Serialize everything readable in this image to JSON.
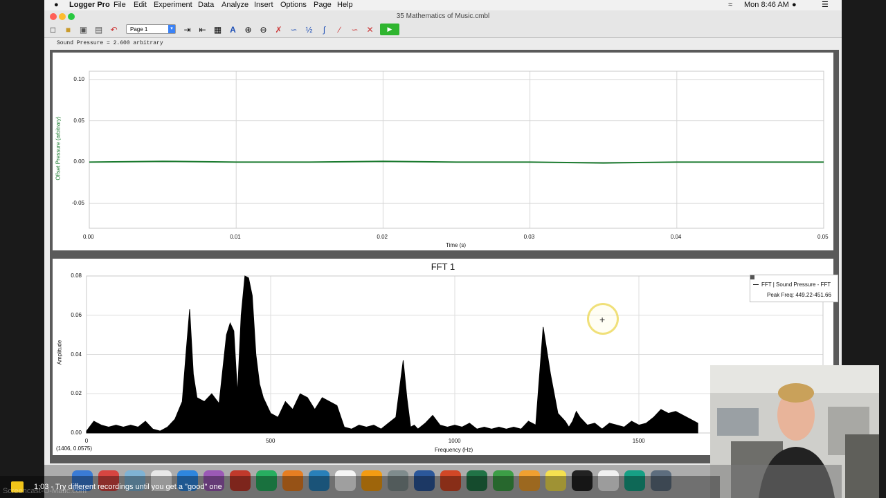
{
  "menubar": {
    "apple_icon": "apple-icon",
    "items": [
      "Logger Pro",
      "File",
      "Edit",
      "Experiment",
      "Data",
      "Analyze",
      "Insert",
      "Options",
      "Page",
      "Help"
    ],
    "clock": "Mon 8:46 AM"
  },
  "window": {
    "title": "35 Mathematics of Music.cmbl",
    "traffic_colors": [
      "#ff5f57",
      "#febc2e",
      "#28c840"
    ]
  },
  "toolbar": {
    "page_select": "Page 1",
    "icons": [
      "new-file",
      "open-folder",
      "save",
      "print",
      "undo",
      "next-page",
      "prev-page",
      "table",
      "autoscale",
      "zoom-in",
      "zoom-out",
      "examine",
      "tangent",
      "interpolate",
      "integral",
      "statistics",
      "curve-fit",
      "model",
      "timer",
      "collect"
    ]
  },
  "status": {
    "readout": "Sound Pressure = 2.600 arbitrary"
  },
  "time_graph": {
    "y_axis_label": "Offset Pressure (arbitrary)",
    "x_axis_label": "Time (s)",
    "y_ticks": [
      "0.10",
      "0.05",
      "0.00",
      "-0.05"
    ],
    "x_ticks": [
      "0.00",
      "0.01",
      "0.02",
      "0.03",
      "0.04",
      "0.05"
    ],
    "line_color": "#1a7a2e"
  },
  "fft_graph": {
    "title": "FFT 1",
    "y_axis_label": "Amplitude",
    "x_axis_label": "Frequency (Hz)",
    "y_ticks": [
      "0.08",
      "0.06",
      "0.04",
      "0.02",
      "0.00"
    ],
    "x_ticks": [
      "0",
      "500",
      "1000",
      "1500"
    ],
    "coord_readout": "(1406, 0.0575)",
    "legend": {
      "series": "FFT | Sound Pressure - FFT",
      "peak": "Peak Freq: 449.22-451.66"
    }
  },
  "chart_data": [
    {
      "type": "line",
      "xlabel": "Time (s)",
      "ylabel": "Offset Pressure (arbitrary)",
      "xlim": [
        0,
        0.05
      ],
      "ylim": [
        -0.08,
        0.11
      ],
      "grid": true,
      "series": [
        {
          "x": [
            0,
            0.005,
            0.01,
            0.015,
            0.02,
            0.025,
            0.03,
            0.035,
            0.04,
            0.045,
            0.05
          ],
          "y": [
            0,
            0.001,
            0,
            0,
            0.001,
            0,
            0,
            -0.001,
            0,
            0,
            0
          ]
        }
      ]
    },
    {
      "type": "area",
      "title": "FFT 1",
      "xlabel": "Frequency (Hz)",
      "ylabel": "Amplitude",
      "xlim": [
        0,
        2000
      ],
      "ylim": [
        0,
        0.08
      ],
      "grid": true,
      "series": [
        {
          "name": "FFT | Sound Pressure - FFT",
          "x": [
            0,
            20,
            40,
            60,
            80,
            100,
            120,
            140,
            160,
            180,
            200,
            220,
            240,
            260,
            270,
            280,
            290,
            300,
            320,
            340,
            360,
            380,
            390,
            400,
            410,
            420,
            430,
            440,
            450,
            460,
            470,
            480,
            500,
            520,
            540,
            560,
            580,
            600,
            620,
            640,
            660,
            680,
            700,
            720,
            740,
            760,
            780,
            800,
            820,
            840,
            860,
            870,
            880,
            890,
            900,
            920,
            940,
            960,
            980,
            1000,
            1020,
            1040,
            1060,
            1080,
            1100,
            1120,
            1140,
            1160,
            1180,
            1200,
            1220,
            1240,
            1260,
            1280,
            1300,
            1310,
            1320,
            1330,
            1340,
            1360,
            1380,
            1400,
            1420,
            1440,
            1460,
            1480,
            1500,
            1520,
            1540,
            1560,
            1580,
            1600,
            1620,
            1640,
            1660
          ],
          "y": [
            0.001,
            0.006,
            0.004,
            0.003,
            0.004,
            0.003,
            0.004,
            0.003,
            0.006,
            0.002,
            0.001,
            0.003,
            0.007,
            0.016,
            0.04,
            0.063,
            0.03,
            0.018,
            0.016,
            0.02,
            0.015,
            0.05,
            0.056,
            0.052,
            0.02,
            0.06,
            0.08,
            0.079,
            0.07,
            0.04,
            0.025,
            0.018,
            0.01,
            0.008,
            0.016,
            0.012,
            0.02,
            0.018,
            0.012,
            0.018,
            0.016,
            0.014,
            0.003,
            0.002,
            0.004,
            0.003,
            0.004,
            0.002,
            0.005,
            0.008,
            0.037,
            0.018,
            0.003,
            0.004,
            0.002,
            0.005,
            0.009,
            0.004,
            0.003,
            0.004,
            0.003,
            0.005,
            0.002,
            0.003,
            0.002,
            0.003,
            0.002,
            0.003,
            0.002,
            0.006,
            0.004,
            0.054,
            0.03,
            0.01,
            0.006,
            0.003,
            0.006,
            0.011,
            0.008,
            0.004,
            0.005,
            0.002,
            0.005,
            0.004,
            0.003,
            0.006,
            0.004,
            0.005,
            0.008,
            0.012,
            0.01,
            0.011,
            0.009,
            0.007,
            0.005
          ]
        }
      ]
    }
  ],
  "caption": {
    "text": "1:03 - Try different recordings until you get a \"good\" one",
    "watermark": "Screencast-O-Matic.com"
  },
  "dock": {
    "icons": [
      "finder-icon",
      "chrome-icon",
      "maps-icon",
      "preview-icon",
      "app-store-icon",
      "itunes-icon",
      "pdf-icon",
      "activity-monitor-icon",
      "firefox-icon",
      "safari-icon",
      "calendar-icon",
      "photos-icon",
      "system-preferences-icon",
      "word-icon",
      "powerpoint-icon",
      "excel-icon",
      "logger-pro-icon",
      "pages-icon",
      "notes-icon",
      "som-icon",
      "textedit-icon",
      "arduino-icon",
      "mail-icon"
    ]
  }
}
